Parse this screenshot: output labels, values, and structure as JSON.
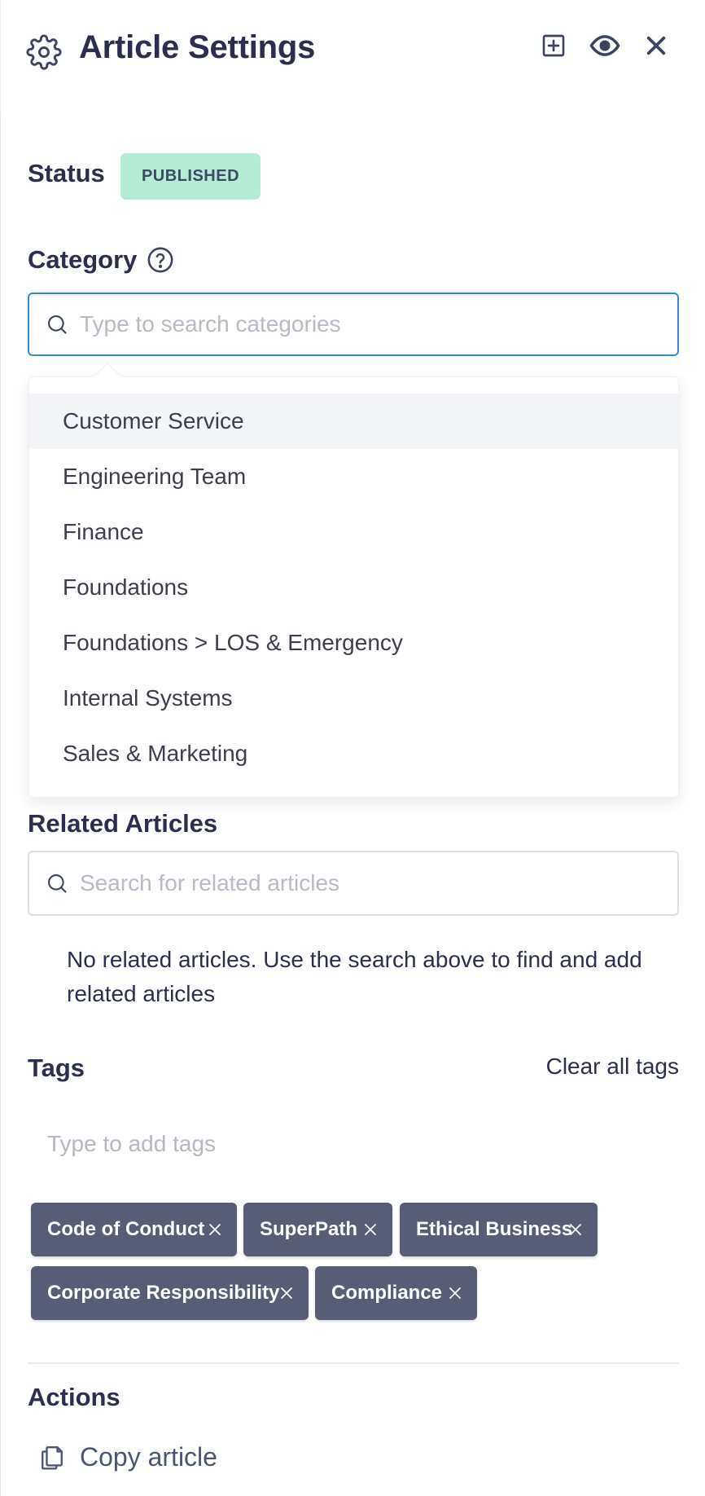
{
  "header": {
    "title": "Article Settings",
    "icons": [
      "gear-icon",
      "plus-square-icon",
      "eye-icon",
      "close-icon"
    ]
  },
  "status": {
    "label": "Status",
    "value": "PUBLISHED",
    "color": "#b4ecd5"
  },
  "category": {
    "label": "Category",
    "placeholder": "Type to search categories",
    "options": [
      "Customer Service",
      "Engineering Team",
      "Finance",
      "Foundations",
      "Foundations > LOS & Emergency",
      "Internal Systems",
      "Sales & Marketing"
    ],
    "highlighted_index": 0
  },
  "related": {
    "label": "Related Articles",
    "placeholder": "Search for related articles",
    "empty_text": "No related articles. Use the search above to find and add related articles"
  },
  "tags": {
    "label": "Tags",
    "clear_label": "Clear all tags",
    "placeholder": "Type to add tags",
    "items": [
      "Code of Conduct",
      "SuperPath",
      "Ethical Business",
      "Corporate Responsibility",
      "Compliance"
    ]
  },
  "actions": {
    "label": "Actions",
    "copy_label": "Copy article"
  },
  "colors": {
    "accent": "#2f8de0",
    "text": "#2c2e50",
    "tag_bg": "#575d74"
  }
}
